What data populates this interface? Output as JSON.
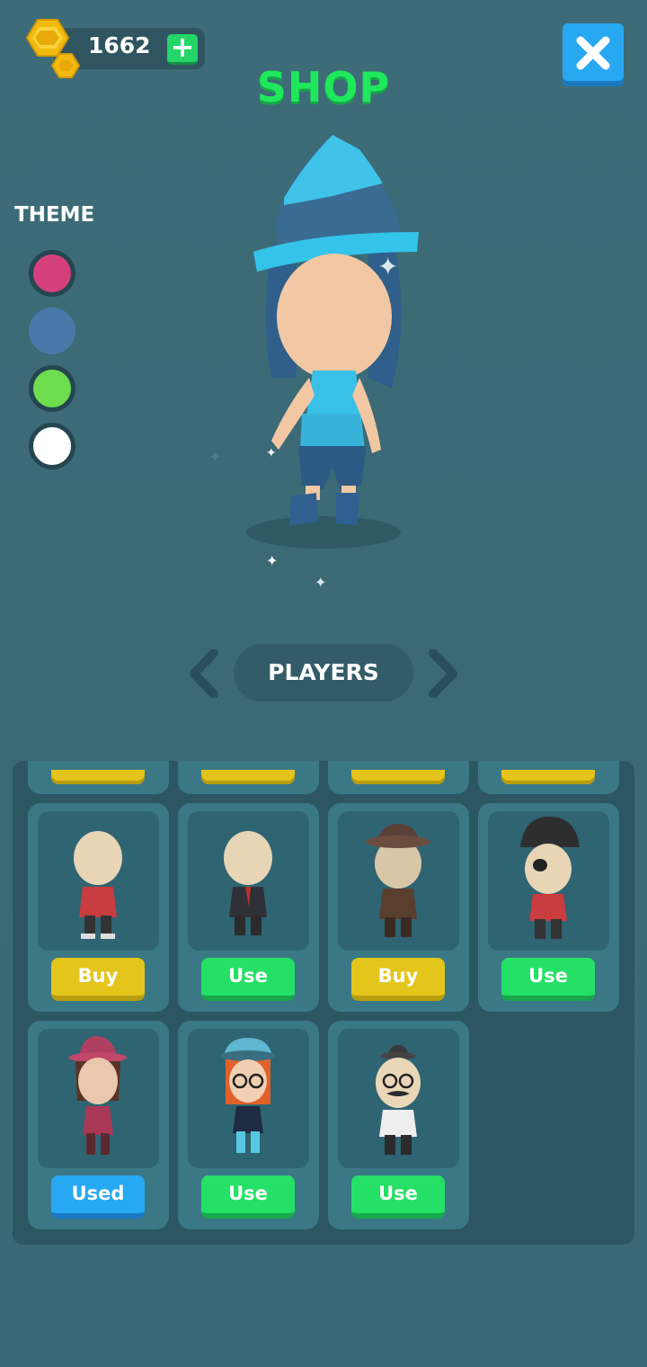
{
  "header": {
    "coins": "1662",
    "coin_icon": "coin-icon",
    "add_coins_icon": "plus-icon",
    "close_icon": "close-icon",
    "title": "SHOP"
  },
  "theme": {
    "label": "THEME",
    "swatches": [
      {
        "color": "#d53f7c",
        "selected": true
      },
      {
        "color": "#4a79a9",
        "selected": false
      },
      {
        "color": "#6ddc4e",
        "selected": true
      },
      {
        "color": "#ffffff",
        "selected": true
      }
    ]
  },
  "category": {
    "label": "PLAYERS",
    "prev_icon": "chevron-left-icon",
    "next_icon": "chevron-right-icon"
  },
  "items": [
    {
      "character": "bald-red-shirt",
      "button": "Buy",
      "state": "buy"
    },
    {
      "character": "bald-suit",
      "button": "Use",
      "state": "use"
    },
    {
      "character": "fedora-brown-coat",
      "button": "Buy",
      "state": "buy"
    },
    {
      "character": "pirate-eyepatch",
      "button": "Use",
      "state": "use"
    },
    {
      "character": "pink-hat-girl",
      "button": "Used",
      "state": "used"
    },
    {
      "character": "beanie-glasses-girl",
      "button": "Use",
      "state": "use"
    },
    {
      "character": "mustache-glasses-man",
      "button": "Use",
      "state": "use"
    }
  ],
  "colors": {
    "accent_green": "#1fe85d",
    "buy_yellow": "#e3c51c",
    "use_green": "#25e066",
    "used_blue": "#27a8f2"
  }
}
